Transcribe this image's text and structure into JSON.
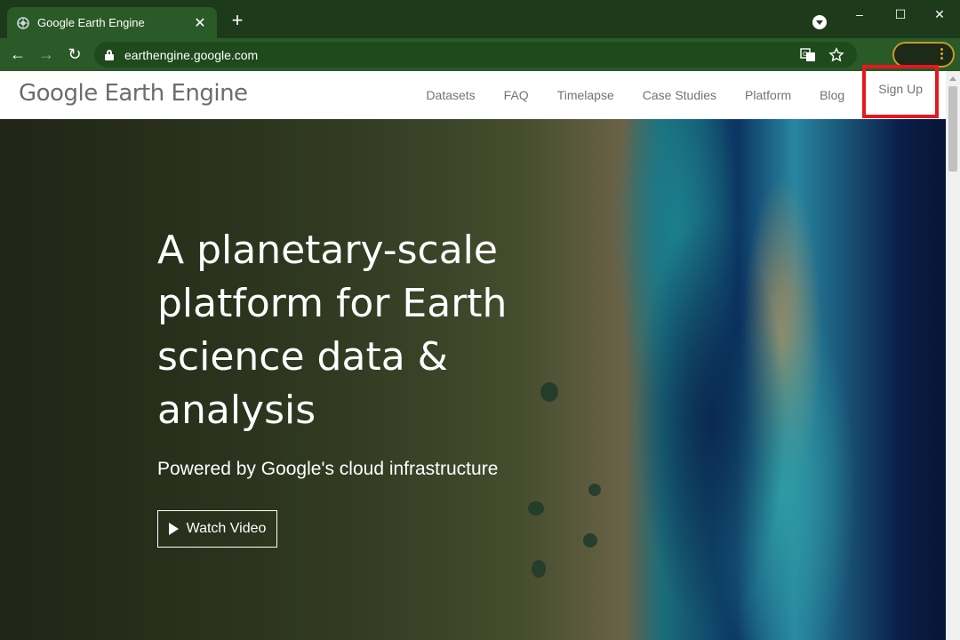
{
  "browser": {
    "tab_title": "Google Earth Engine",
    "tab_close": "✕",
    "new_tab": "+",
    "url": "earthengine.google.com",
    "window_controls": {
      "minimize": "–",
      "maximize": "☐",
      "close": "✕"
    },
    "nav": {
      "back": "←",
      "forward": "→",
      "reload": "↻"
    },
    "omnibox_icons": [
      "translate-icon",
      "star-icon"
    ],
    "theme_color": "#2a5a27"
  },
  "header": {
    "logo": "Google Earth Engine",
    "nav_links": [
      "Datasets",
      "FAQ",
      "Timelapse",
      "Case Studies",
      "Platform",
      "Blog",
      "Sign Up"
    ],
    "highlight_color": "#e5171f"
  },
  "hero": {
    "heading": "A planetary-scale platform for Earth science data & analysis",
    "subheading": "Powered by Google's cloud infrastructure",
    "watch_button": "Watch Video"
  }
}
